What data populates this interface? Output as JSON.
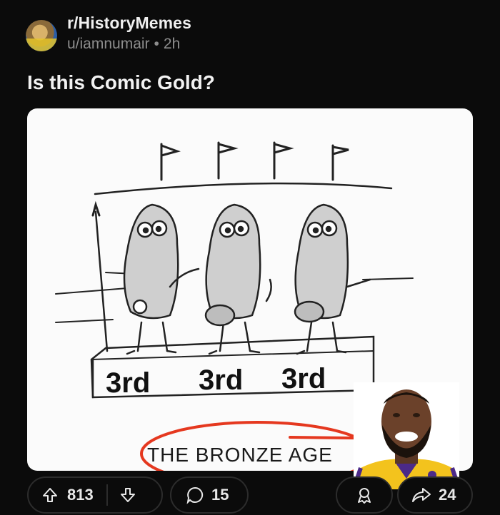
{
  "post": {
    "subreddit": "r/HistoryMemes",
    "author": "u/iamnumair",
    "separator": "•",
    "age": "2h",
    "title": "Is this Comic Gold?"
  },
  "comic": {
    "podium_labels": [
      "3rd",
      "3rd",
      "3rd"
    ],
    "caption": "THE BRONZE AGE"
  },
  "actions": {
    "upvotes": "813",
    "comments": "15",
    "shares": "24"
  },
  "colors": {
    "background": "#0b0b0b",
    "annotation_red": "#e5381f",
    "meta_gray": "#8d8d8d"
  },
  "icons": [
    "upvote-icon",
    "downvote-icon",
    "comment-icon",
    "award-icon",
    "share-icon"
  ]
}
